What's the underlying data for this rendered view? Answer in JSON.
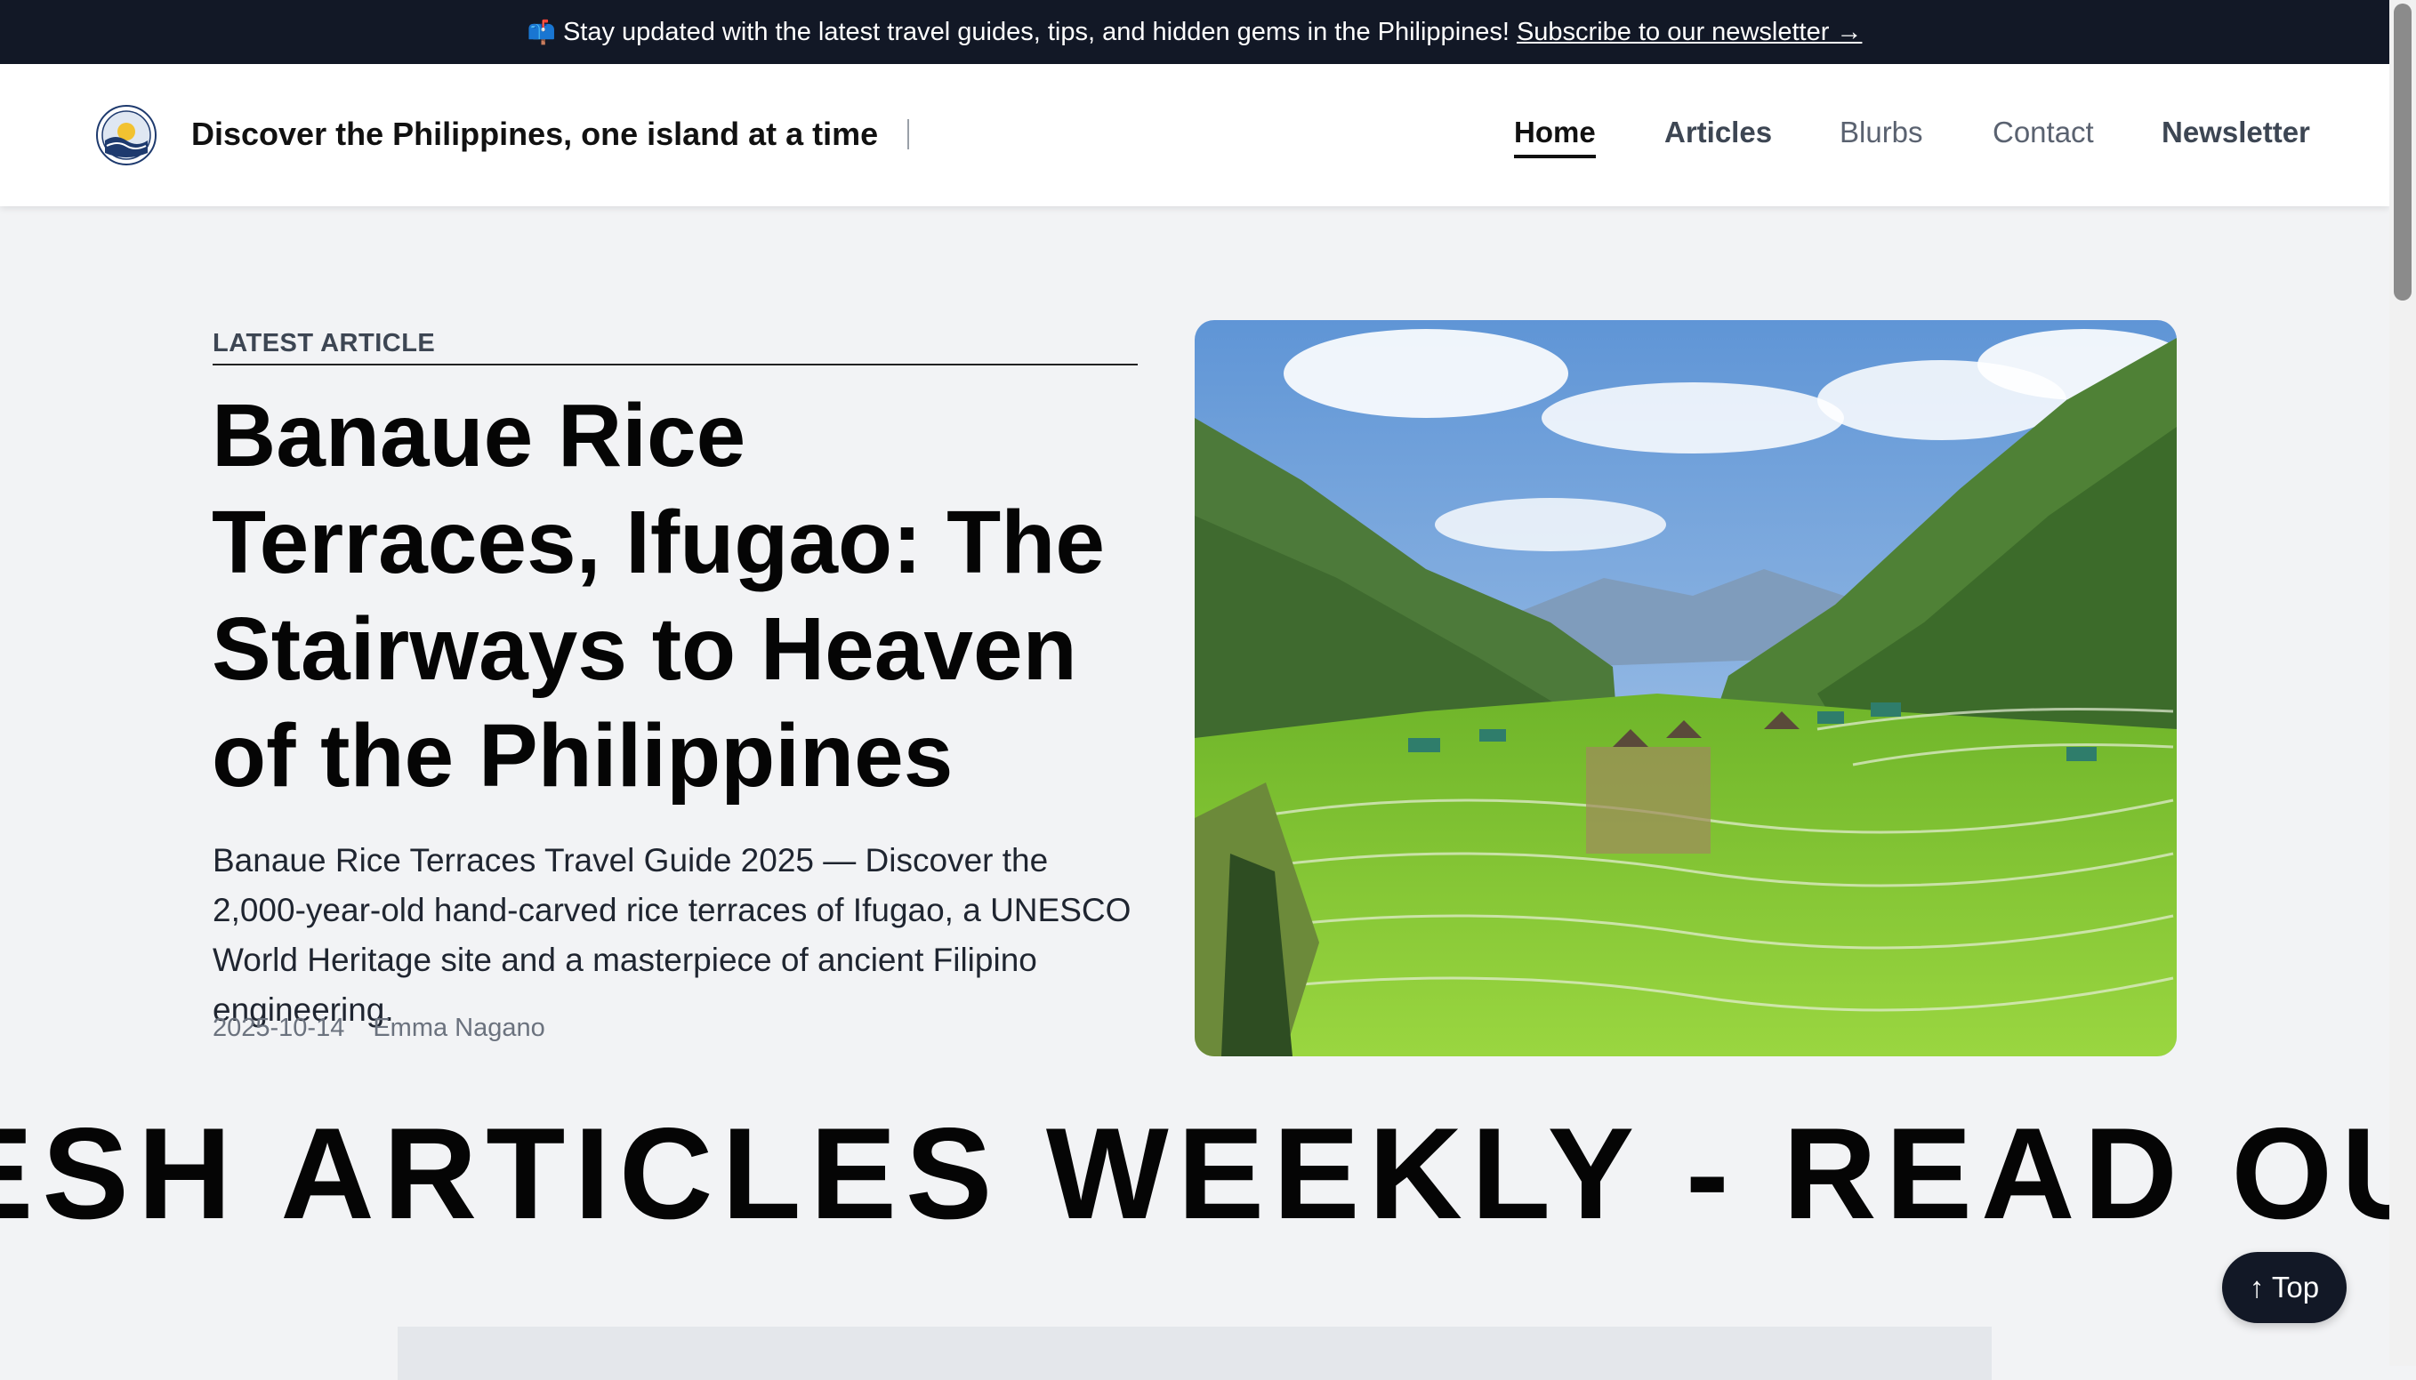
{
  "announcement": {
    "icon": "mailbox-icon",
    "text": "Stay updated with the latest travel guides, tips, and hidden gems in the Philippines!",
    "link": "Subscribe to our newsletter →"
  },
  "header": {
    "tagline": "Discover the Philippines, one island at a time",
    "nav": [
      {
        "label": "Home",
        "active": true
      },
      {
        "label": "Articles"
      },
      {
        "label": "Blurbs"
      },
      {
        "label": "Contact"
      },
      {
        "label": "Newsletter"
      }
    ]
  },
  "featured": {
    "kicker": "LATEST ARTICLE",
    "title": "Banaue Rice Terraces, Ifugao: The Stairways to Heaven of the Philippines",
    "excerpt": "Banaue Rice Terraces Travel Guide 2025 — Discover the 2,000-year-old hand-carved rice terraces of Ifugao, a UNESCO World Heritage site and a masterpiece of ancient Filipino engineering.",
    "date": "2025-10-14",
    "author": "Emma Nagano"
  },
  "marquee": "ESH ARTICLES WEEKLY - READ OUR L",
  "back_to_top": "↑ Top",
  "colors": {
    "announce_bg": "#121826",
    "page_bg": "#f2f3f5",
    "rice_green": "#7cc230"
  }
}
